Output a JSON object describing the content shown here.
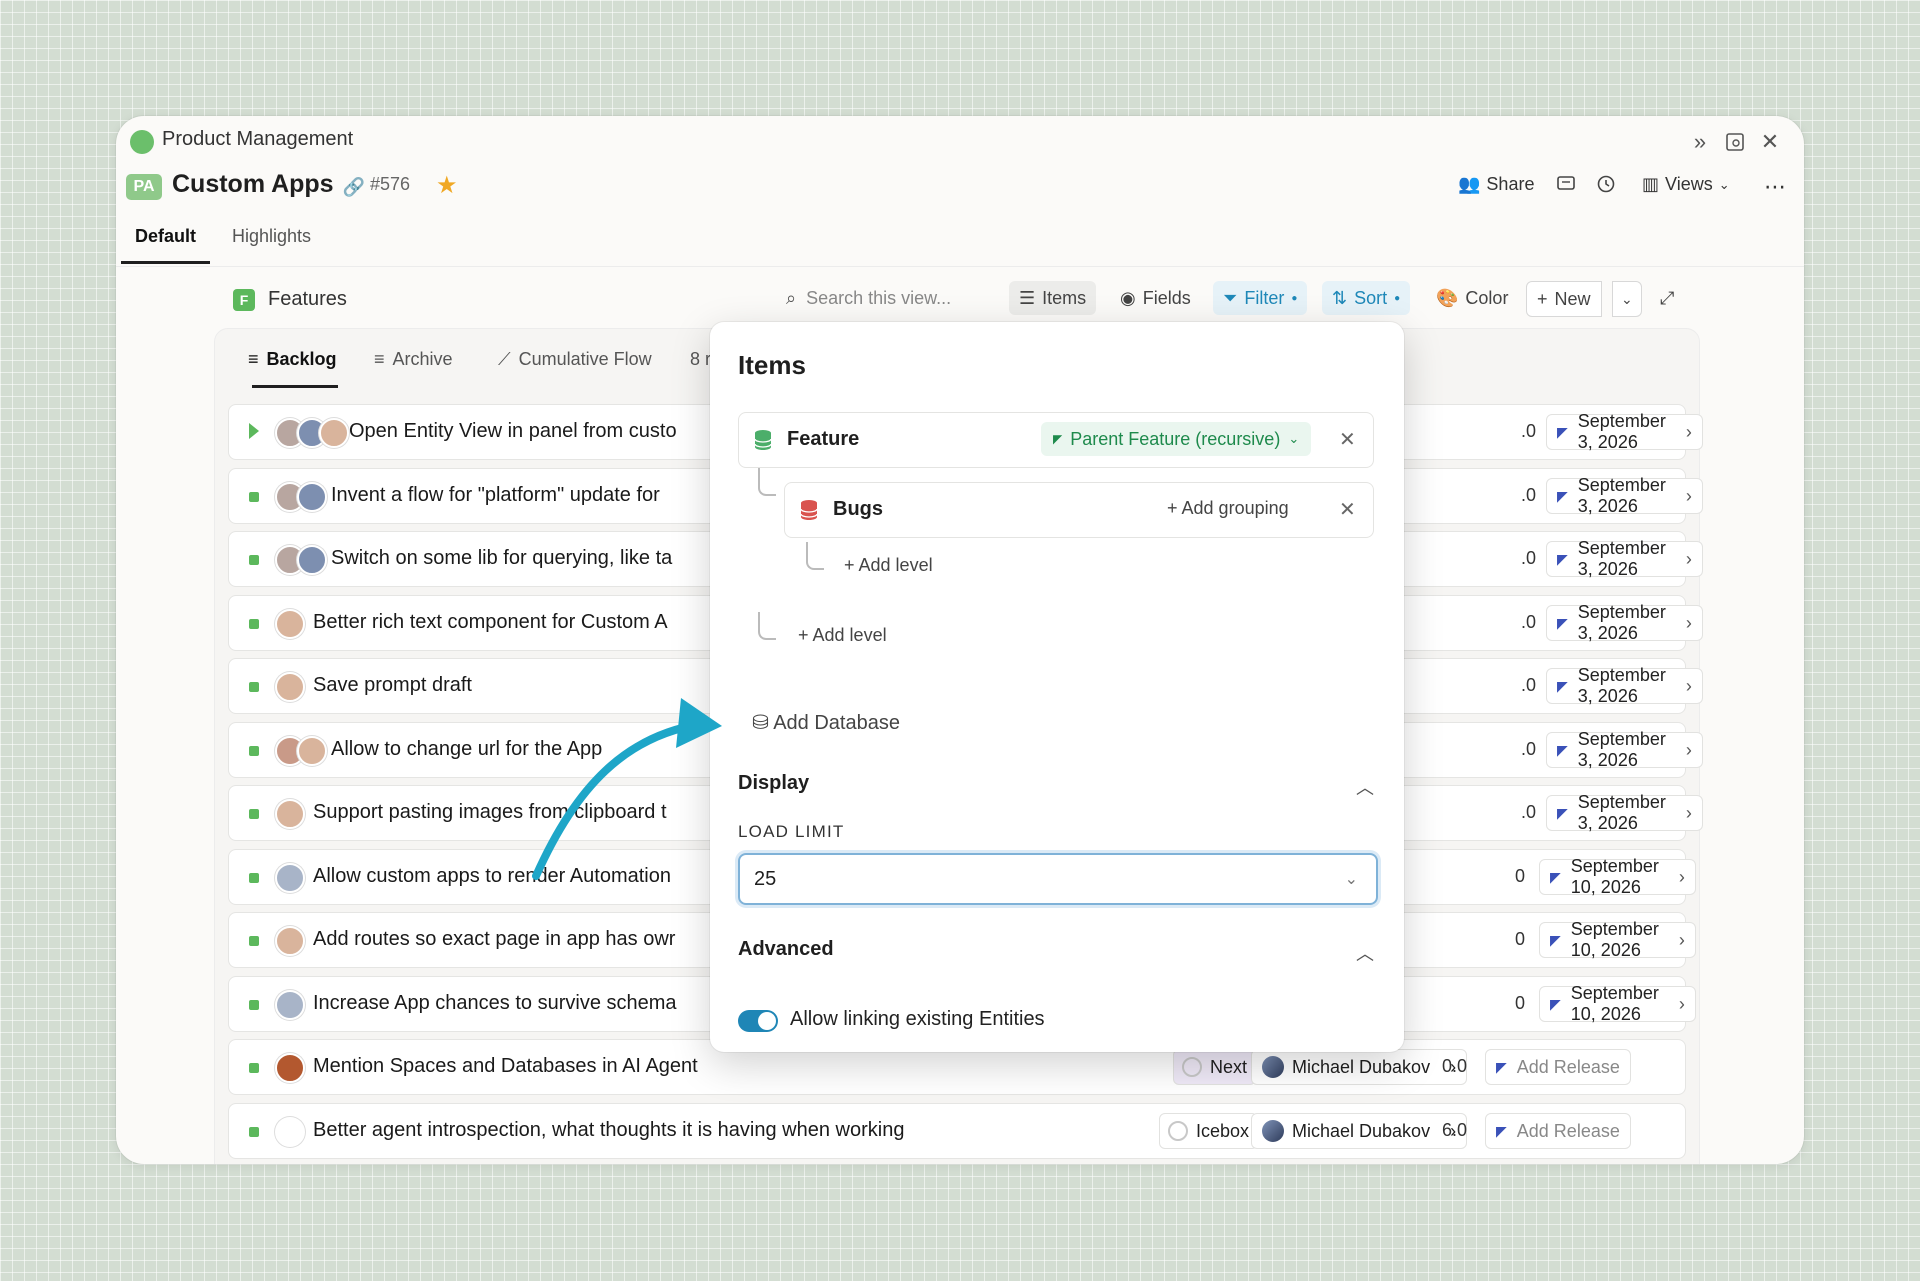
{
  "window": {
    "app_title": "Product Management",
    "page_badge": "PA",
    "page_title": "Custom Apps",
    "issue_number": "#576",
    "header_actions": {
      "share": "Share",
      "views": "Views"
    }
  },
  "tabs": [
    "Default",
    "Highlights"
  ],
  "section": {
    "badge": "F",
    "title": "Features",
    "search_placeholder": "Search this view...",
    "toolbar": {
      "items": "Items",
      "fields": "Fields",
      "filter": "Filter",
      "sort": "Sort",
      "color": "Color",
      "new": "New"
    }
  },
  "view_tabs": [
    "Backlog",
    "Archive",
    "Cumulative Flow",
    "8 r"
  ],
  "rows": [
    {
      "title": "Open Entity View in panel from custo",
      "estimate": ".0",
      "date": "September 3, 2026",
      "expand": true
    },
    {
      "title": "Invent a flow for \"platform\" update for",
      "estimate": ".0",
      "date": "September 3, 2026"
    },
    {
      "title": "Switch on some lib for querying, like ta",
      "estimate": ".0",
      "date": "September 3, 2026"
    },
    {
      "title": "Better rich text component for Custom A",
      "estimate": ".0",
      "date": "September 3, 2026"
    },
    {
      "title": "Save prompt draft",
      "estimate": ".0",
      "date": "September 3, 2026"
    },
    {
      "title": "Allow to change url for the App",
      "estimate": ".0",
      "date": "September 3, 2026"
    },
    {
      "title": "Support pasting images from clipboard t",
      "estimate": ".0",
      "date": "September 3, 2026"
    },
    {
      "title": "Allow custom apps to render Automation",
      "estimate": "0",
      "date": "September 10, 2026"
    },
    {
      "title": "Add routes so exact page in app has owr",
      "estimate": "0",
      "date": "September 10, 2026"
    },
    {
      "title": "Increase App chances to survive schema",
      "estimate": "0",
      "date": "September 10, 2026"
    },
    {
      "title": "Mention Spaces and Databases in AI Agent",
      "status": "Next",
      "owner": "Michael Dubakov",
      "estimate": "0.0",
      "release": "Add Release"
    },
    {
      "title": "Better agent introspection, what thoughts it is having when working",
      "status": "Icebox",
      "owner": "Michael Dubakov",
      "estimate": "6.0",
      "release": "Add Release"
    }
  ],
  "popover": {
    "title": "Items",
    "group_primary": {
      "name": "Feature",
      "parent_chip": "Parent Feature (recursive)"
    },
    "group_secondary": {
      "name": "Bugs",
      "add_grouping": "Add grouping"
    },
    "add_level": "Add level",
    "add_database": "Add Database",
    "display": {
      "heading": "Display",
      "load_limit_label": "LOAD LIMIT",
      "load_limit_value": "25"
    },
    "advanced": {
      "heading": "Advanced",
      "toggle_label": "Allow linking existing Entities",
      "toggle_on": true
    }
  },
  "colors": {
    "accent_blue": "#1f86b6",
    "green": "#5cb85c",
    "arrow_teal": "#1ea6c8"
  }
}
